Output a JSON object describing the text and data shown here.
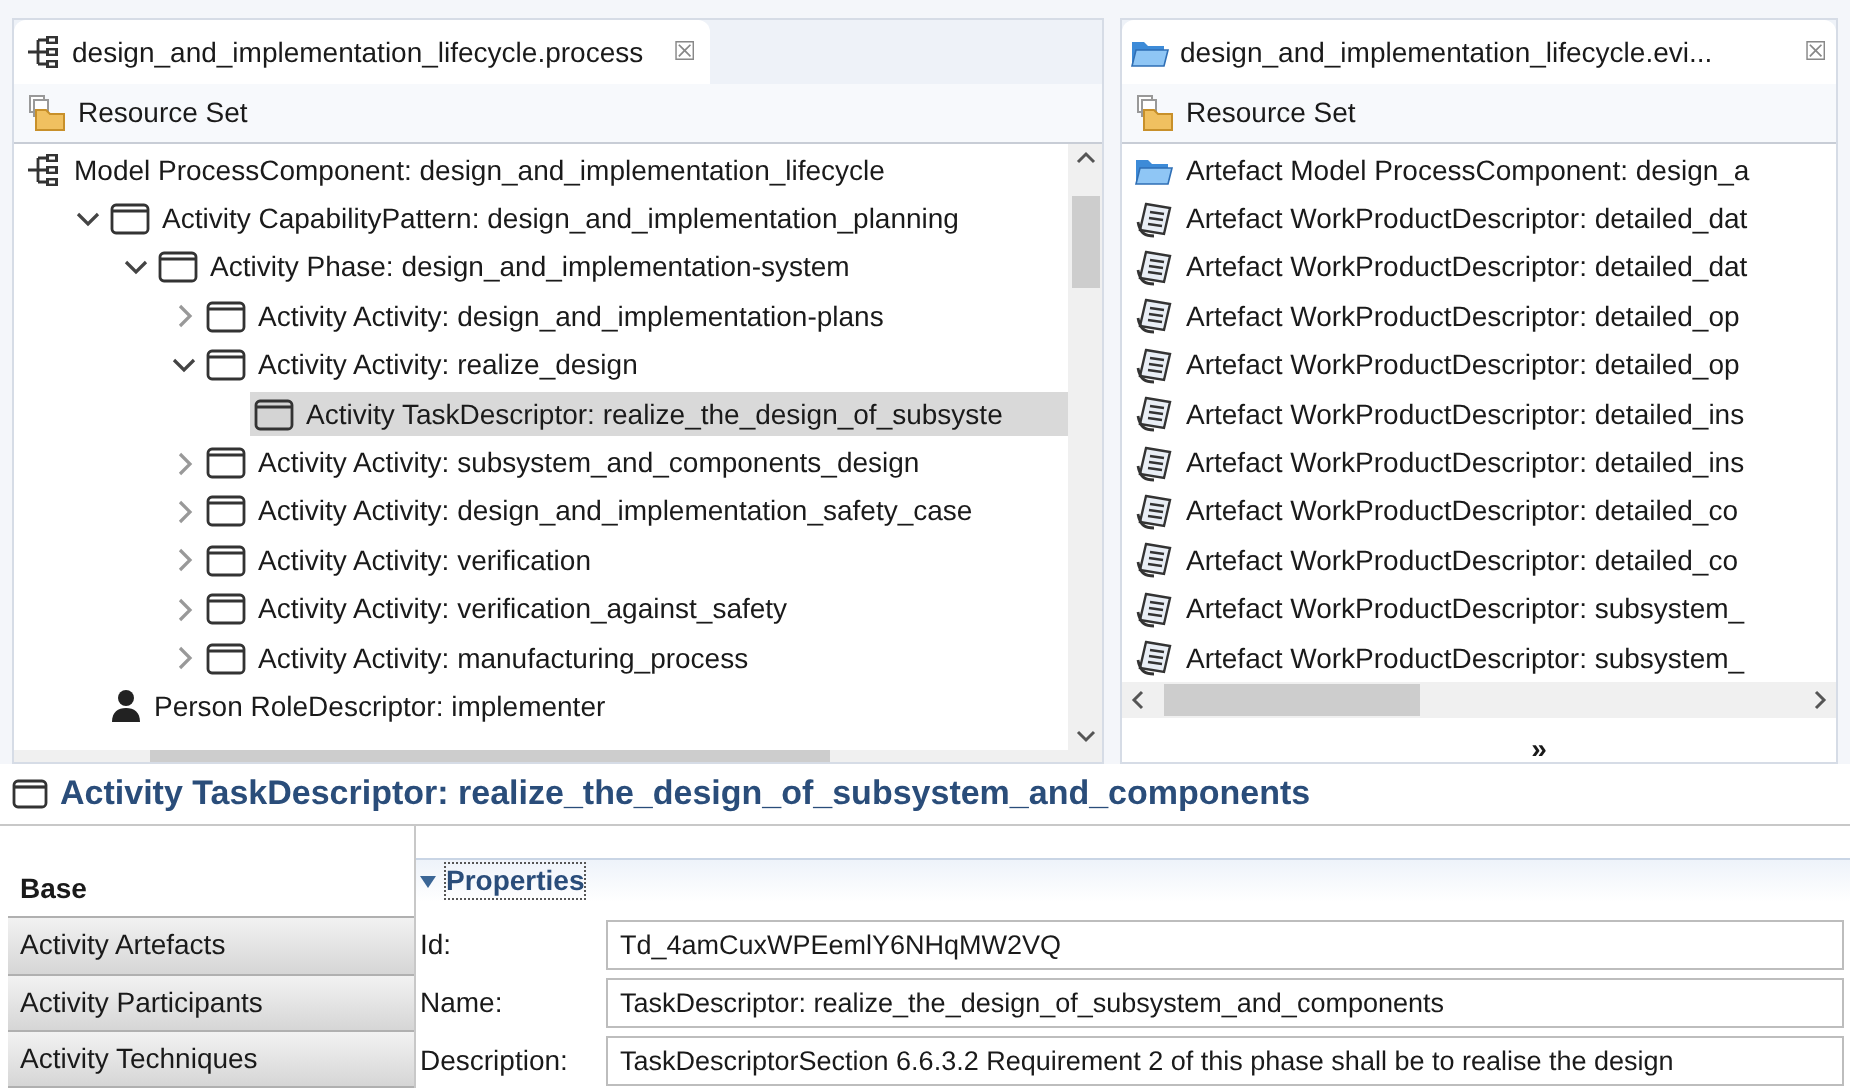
{
  "process_editor": {
    "tab": {
      "title": "design_and_implementation_lifecycle.process",
      "close": "☒"
    },
    "toolbar": {
      "label": "Resource Set"
    },
    "tree": [
      {
        "kind": "process",
        "label": "Model ProcessComponent: design_and_implementation_lifecycle",
        "selected": false,
        "children": [
          {
            "kind": "activity",
            "label": "Activity CapabilityPattern: design_and_implementation_planning",
            "expanded": true,
            "selected": false,
            "children": [
              {
                "kind": "activity",
                "label": "Activity Phase: design_and_implementation-system",
                "expanded": true,
                "selected": false,
                "children": [
                  {
                    "kind": "activity",
                    "label": "Activity Activity: design_and_implementation-plans",
                    "expanded": false,
                    "selected": false
                  },
                  {
                    "kind": "activity",
                    "label": "Activity Activity: realize_design",
                    "expanded": true,
                    "selected": false,
                    "children": [
                      {
                        "kind": "activity",
                        "label": "Activity TaskDescriptor: realize_the_design_of_subsyste",
                        "selected": true
                      }
                    ]
                  },
                  {
                    "kind": "activity",
                    "label": "Activity Activity: subsystem_and_components_design",
                    "expanded": false,
                    "selected": false
                  },
                  {
                    "kind": "activity",
                    "label": "Activity Activity: design_and_implementation_safety_case",
                    "expanded": false,
                    "selected": false
                  },
                  {
                    "kind": "activity",
                    "label": "Activity Activity: verification",
                    "expanded": false,
                    "selected": false
                  },
                  {
                    "kind": "activity",
                    "label": "Activity Activity: verification_against_safety",
                    "expanded": false,
                    "selected": false
                  },
                  {
                    "kind": "activity",
                    "label": "Activity Activity: manufacturing_process",
                    "expanded": false,
                    "selected": false
                  }
                ]
              }
            ]
          },
          {
            "kind": "person",
            "label": "Person RoleDescriptor: implementer",
            "selected": false
          }
        ]
      }
    ]
  },
  "evidence_editor": {
    "tab": {
      "title": "design_and_implementation_lifecycle.evi...",
      "close": "☒"
    },
    "toolbar": {
      "label": "Resource Set"
    },
    "items": [
      {
        "kind": "folder",
        "label": "Artefact Model ProcessComponent: design_a"
      },
      {
        "kind": "document",
        "label": "Artefact WorkProductDescriptor: detailed_dat"
      },
      {
        "kind": "document",
        "label": "Artefact WorkProductDescriptor: detailed_dat"
      },
      {
        "kind": "document",
        "label": "Artefact WorkProductDescriptor: detailed_op"
      },
      {
        "kind": "document",
        "label": "Artefact WorkProductDescriptor: detailed_op"
      },
      {
        "kind": "document",
        "label": "Artefact WorkProductDescriptor: detailed_ins"
      },
      {
        "kind": "document",
        "label": "Artefact WorkProductDescriptor: detailed_ins"
      },
      {
        "kind": "document",
        "label": "Artefact WorkProductDescriptor: detailed_co"
      },
      {
        "kind": "document",
        "label": "Artefact WorkProductDescriptor: detailed_co"
      },
      {
        "kind": "document",
        "label": "Artefact WorkProductDescriptor: subsystem_"
      },
      {
        "kind": "document",
        "label": "Artefact WorkProductDescriptor: subsystem_"
      }
    ],
    "overflow": "»"
  },
  "properties": {
    "title": "Activity TaskDescriptor: realize_the_design_of_subsystem_and_components",
    "tabs": [
      {
        "label": "Base",
        "selected": true
      },
      {
        "label": "Activity Artefacts",
        "selected": false
      },
      {
        "label": "Activity Participants",
        "selected": false
      },
      {
        "label": "Activity Techniques",
        "selected": false
      }
    ],
    "section": {
      "title": "Properties",
      "expanded": true
    },
    "fields": [
      {
        "label": "Id:",
        "value": "Td_4amCuxWPEemlY6NHqMW2VQ"
      },
      {
        "label": "Name:",
        "value": "TaskDescriptor: realize_the_design_of_subsystem_and_components"
      },
      {
        "label": "Description:",
        "value": "TaskDescriptorSection 6.6.3.2 Requirement 2 of this phase shall be to realise the design"
      }
    ]
  }
}
